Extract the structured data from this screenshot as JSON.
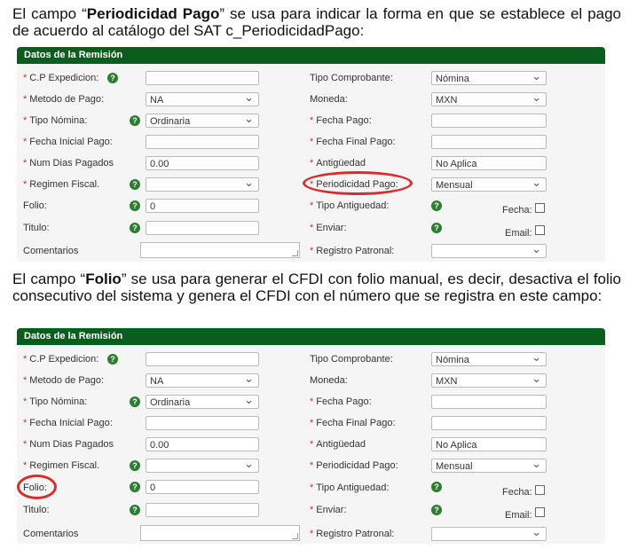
{
  "para1": {
    "pre": "El campo “",
    "bold": "Periodicidad Pago",
    "post": "” se usa para indicar la forma en que se establece el pago de acuerdo al catálogo del SAT c_PeriodicidadPago:"
  },
  "para2": {
    "pre": "El campo “",
    "bold": "Folio",
    "post": "” se usa para generar el CFDI con folio manual, es decir, desactiva el folio consecutivo del sistema y genera el CFDI con el número que se registra en este campo:"
  },
  "form": {
    "title": "Datos de la Remisión",
    "help_glyph": "?",
    "cp_label": "C.P Expedicion:",
    "metodo_label": "Metodo de Pago:",
    "metodo_value": "NA",
    "tipo_nomina_label": "Tipo Nómina:",
    "tipo_nomina_value": "Ordinaria",
    "fecha_inicial_label": "Fecha Inicial Pago:",
    "num_dias_label": "Num Dias Pagados",
    "num_dias_value": "0.00",
    "regimen_label": "Regimen Fiscal.",
    "folio_label": "Folio:",
    "folio_value": "0",
    "titulo_label": "Titulo:",
    "comentarios_label": "Comentarios",
    "tipo_comprobante_label": "Tipo Comprobante:",
    "tipo_comprobante_value": "Nómina",
    "moneda_label": "Moneda:",
    "moneda_value": "MXN",
    "fecha_pago_label": "Fecha Pago:",
    "fecha_final_label": "Fecha Final Pago:",
    "antiguedad_label": "Antigüedad",
    "antiguedad_value": "No Aplica",
    "periodicidad_label": "Periodicidad Pago:",
    "periodicidad_value": "Mensual",
    "tipo_antiguedad_label": "Tipo Antiguedad:",
    "enviar_label": "Enviar:",
    "registro_label": "Registro Patronal:",
    "fecha_chk_label": "Fecha:",
    "email_chk_label": "Email:"
  },
  "highlight_color": "#d62d2d",
  "header_color": "#0b5d1e"
}
